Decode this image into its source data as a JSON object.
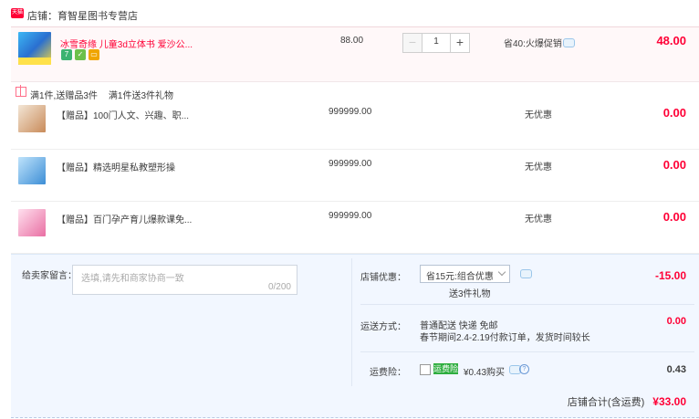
{
  "shop": {
    "label": "店铺：",
    "name": "育智星图书专营店",
    "badge": "天猫"
  },
  "main_item": {
    "title": "冰雪奇缘 儿童3d立体书 爱沙公...",
    "price": "88.00",
    "quantity": "1",
    "promo": "省40:火爆促销",
    "total": "48.00",
    "badges": [
      {
        "icon": "seven-days-icon",
        "label": "7",
        "color": "#3cb371"
      },
      {
        "icon": "shield-icon",
        "label": "✓",
        "color": "#6cc04a"
      },
      {
        "icon": "card-icon",
        "label": "▭",
        "color": "#f0a500"
      }
    ]
  },
  "gift_promo": {
    "text": "满1件,送赠品3件",
    "text2": "满1件送3件礼物"
  },
  "gifts": [
    {
      "title": "【赠品】100门人文、兴趣、职...",
      "price": "999999.00",
      "promo": "无优惠",
      "total": "0.00",
      "color": "#c98b5a"
    },
    {
      "title": "【赠品】精选明星私教塑形操",
      "price": "999999.00",
      "promo": "无优惠",
      "total": "0.00",
      "color": "#3d8ed6"
    },
    {
      "title": "【赠品】百门孕产育儿爆款课免...",
      "price": "999999.00",
      "promo": "无优惠",
      "total": "0.00",
      "color": "#e96fa3"
    }
  ],
  "message": {
    "label": "给卖家留言：",
    "placeholder": "选填,请先和商家协商一致",
    "count": "0/200"
  },
  "store_discount": {
    "label": "店铺优惠：",
    "selected": "省15元:组合优惠",
    "extra": "送3件礼物",
    "value": "-15.00"
  },
  "shipping": {
    "label": "运送方式：",
    "line1": "普通配送 快递 免邮",
    "line2": "春节期间2.4-2.19付款订单，发货时间较长",
    "value": "0.00"
  },
  "insurance": {
    "label": "运费险：",
    "badge": "运费险",
    "text": "¥0.43购买",
    "value": "0.43"
  },
  "total": {
    "label": "店铺合计(含运费)",
    "amount": "¥33.00"
  }
}
